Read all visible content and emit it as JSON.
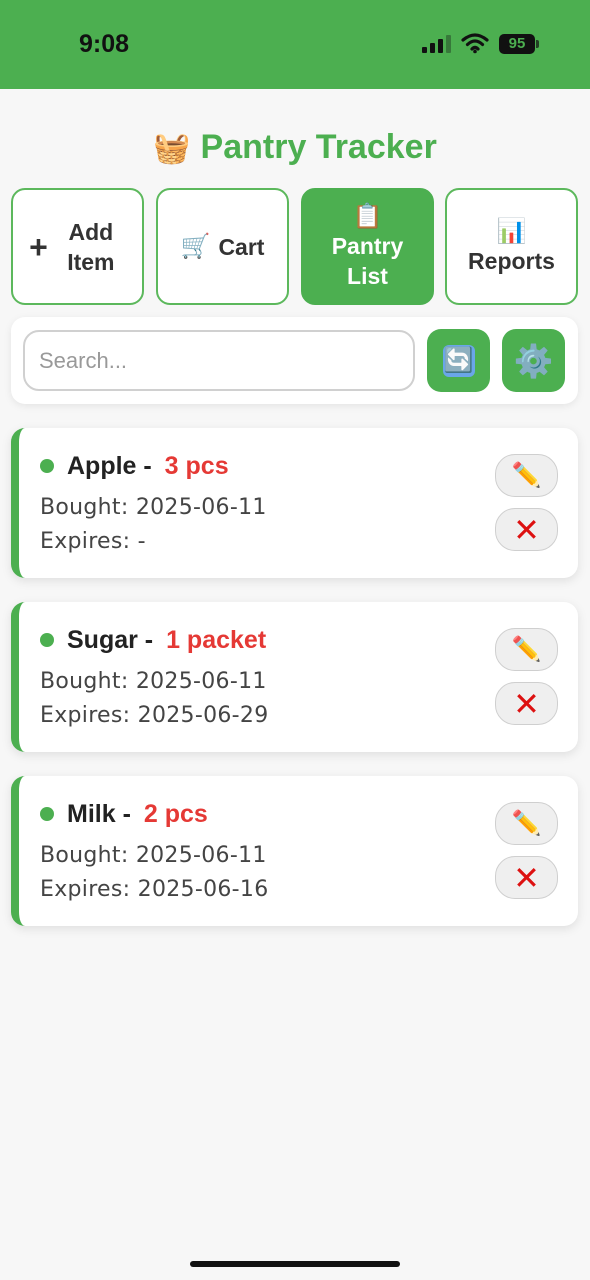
{
  "status_bar": {
    "time": "9:08",
    "battery": "95"
  },
  "app": {
    "emoji": "🧺",
    "title": "Pantry Tracker"
  },
  "tabs": [
    {
      "icon": "+",
      "label": "Add Item"
    },
    {
      "icon": "🛒",
      "label": "Cart"
    },
    {
      "icon": "📋",
      "label": "Pantry List",
      "active": true
    },
    {
      "icon": "📊",
      "label": "Reports"
    }
  ],
  "search": {
    "placeholder": "Search...",
    "refresh_icon": "🔄",
    "settings_icon": "⚙️"
  },
  "items": [
    {
      "name": "Apple",
      "separator": " - ",
      "qty": "3 pcs",
      "bought": "Bought: 2025-06-11",
      "expires": "Expires: -"
    },
    {
      "name": "Sugar",
      "separator": " - ",
      "qty": "1 packet",
      "bought": "Bought: 2025-06-11",
      "expires": "Expires: 2025-06-29"
    },
    {
      "name": "Milk",
      "separator": " - ",
      "qty": "2 pcs",
      "bought": "Bought: 2025-06-11",
      "expires": "Expires: 2025-06-16"
    }
  ],
  "actions": {
    "edit_icon": "✏️",
    "delete_icon": "✕"
  },
  "colors": {
    "brand": "#4caf50",
    "quantity": "#e53935",
    "delete": "#dd1111"
  }
}
